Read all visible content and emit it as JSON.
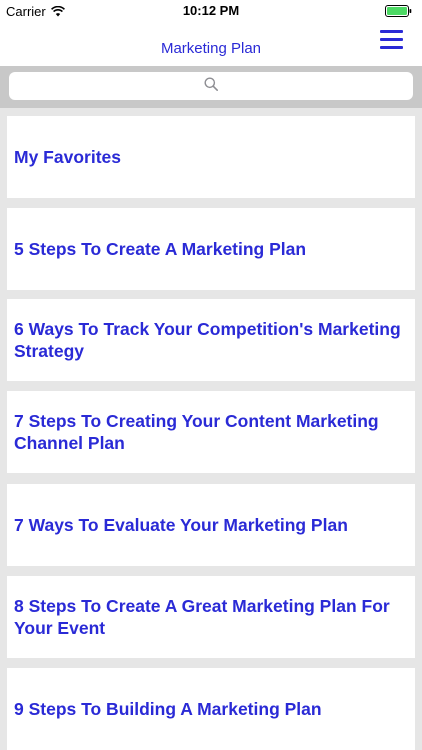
{
  "status_bar": {
    "carrier": "Carrier",
    "time": "10:12 PM",
    "battery_color": "#4cd964"
  },
  "nav": {
    "title": "Marketing Plan",
    "accent_color": "#2a2ad6"
  },
  "search": {
    "placeholder": ""
  },
  "list": {
    "items": [
      {
        "label": "My Favorites"
      },
      {
        "label": "5 Steps To Create A Marketing Plan"
      },
      {
        "label": "6 Ways To Track Your Competition's Marketing Strategy"
      },
      {
        "label": "7 Steps To Creating Your Content Marketing Channel Plan"
      },
      {
        "label": "7 Ways To Evaluate Your Marketing Plan"
      },
      {
        "label": "8 Steps To Create A Great Marketing Plan For Your Event"
      },
      {
        "label": "9 Steps To Building A Marketing Plan"
      }
    ]
  }
}
